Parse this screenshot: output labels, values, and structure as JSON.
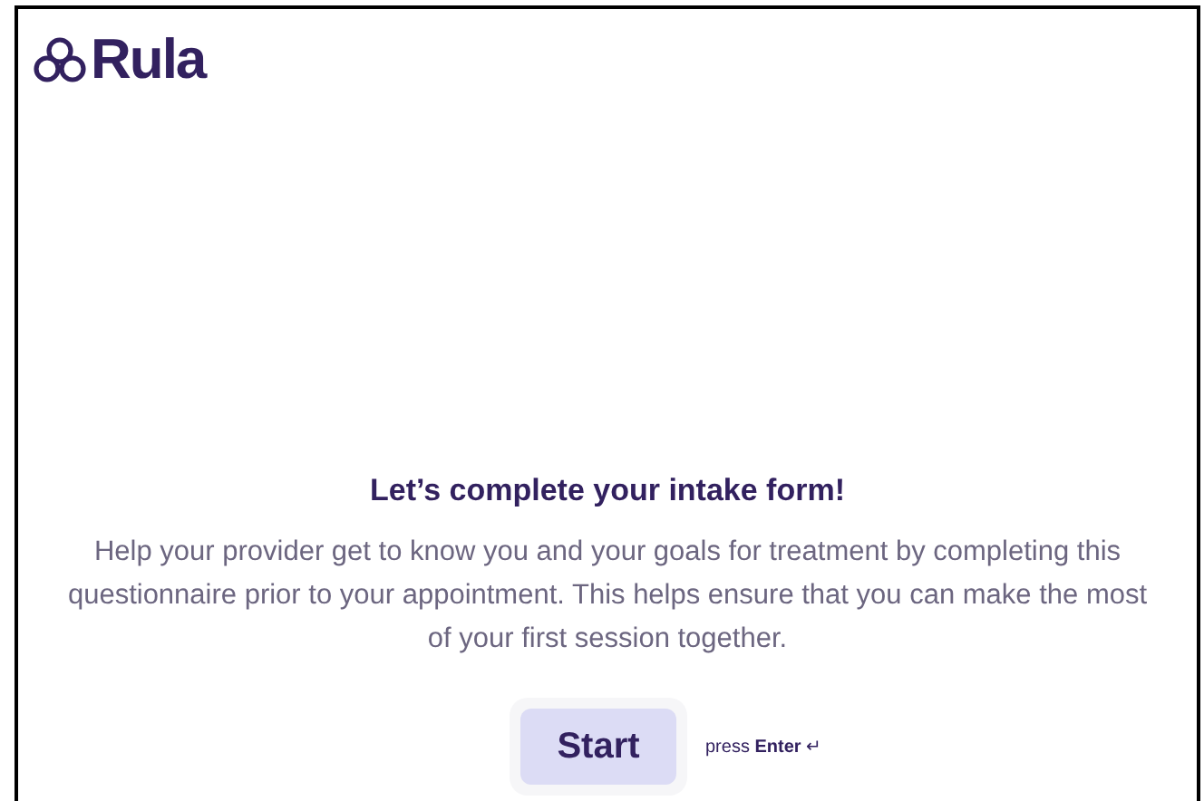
{
  "logo": {
    "text": "Rula"
  },
  "heading": "Let’s complete your intake form!",
  "description": "Help your provider get to know you and your goals for treatment by completing this questionnaire prior to your appointment. This helps ensure that you can make the most of your first session together.",
  "start_button": {
    "label": "Start"
  },
  "hint": "press **Enter** ↵"
}
